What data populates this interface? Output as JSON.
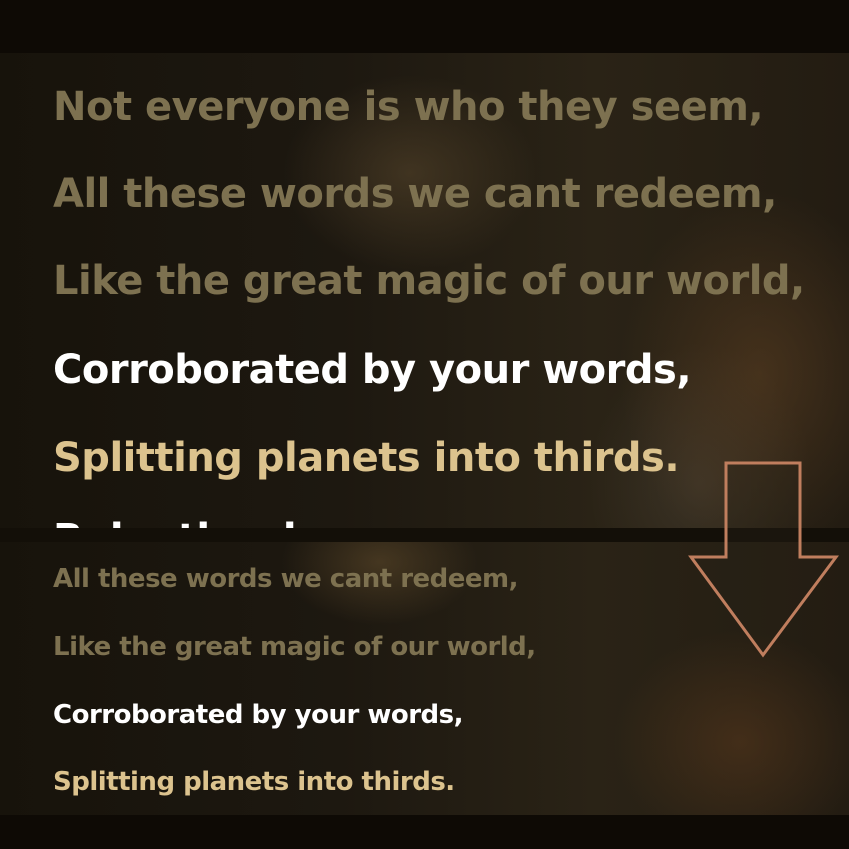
{
  "lyrics_large": {
    "line1": "Not everyone is who they seem,",
    "line2": "All these words we cant redeem,",
    "line3": "Like the great magic of our world,",
    "line4": "Corroborated by your words,",
    "line5": "Splitting planets into thirds.",
    "line6": "Relentlessly"
  },
  "lyrics_small": {
    "line1": "All these words we cant redeem,",
    "line2": "Like the great magic of our world,",
    "line3": "Corroborated by your words,",
    "line4": "Splitting planets into thirds."
  },
  "colors": {
    "past_line": "#7d7150",
    "current_line": "#ffffff",
    "upcoming_line": "#dcc38e",
    "arrow_stroke": "#c07e5e",
    "background": "#0e0a05"
  },
  "icons": {
    "scroll_indicator": "arrow-down-icon"
  }
}
